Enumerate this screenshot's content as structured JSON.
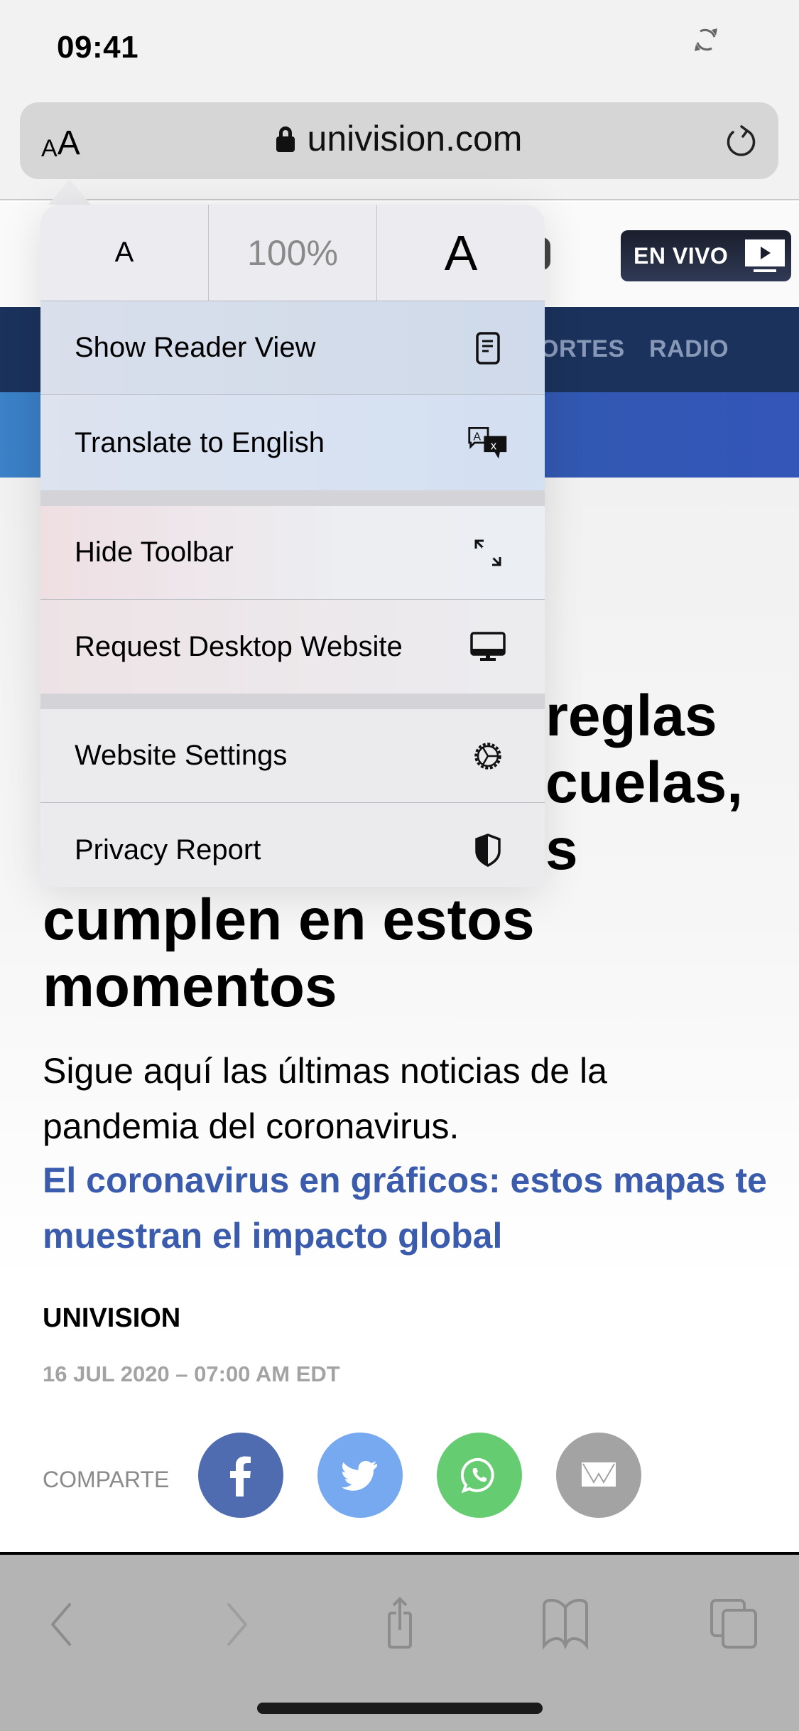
{
  "status_bar": {
    "time": "09:41",
    "sync_icon": "arrows-rotate-icon"
  },
  "url_bar": {
    "text_size_button": {
      "small_a": "A",
      "big_a": "A"
    },
    "domain": "univision.com",
    "lock_icon": "lock-icon",
    "reload_icon": "reload-icon"
  },
  "site": {
    "live_button": {
      "label": "EN VIVO",
      "icon": "tv-play-icon"
    },
    "nav": [
      {
        "label": "ORTES"
      },
      {
        "label": "RADIO"
      }
    ],
    "colors": {
      "nav_bg": "#1b325c",
      "subbar": "#3356b9",
      "live_bg": "#1a1e2c"
    }
  },
  "popover": {
    "zoom": {
      "decrease": "A",
      "level": "100%",
      "increase": "A"
    },
    "groups": [
      [
        {
          "label": "Show Reader View",
          "icon": "reader-view-icon"
        },
        {
          "label": "Translate to English",
          "icon": "translate-icon"
        }
      ],
      [
        {
          "label": "Hide Toolbar",
          "icon": "expand-arrows-icon"
        },
        {
          "label": "Request Desktop Website",
          "icon": "desktop-icon"
        }
      ],
      [
        {
          "label": "Website Settings",
          "icon": "gear-icon"
        },
        {
          "label": "Privacy Report",
          "icon": "shield-icon"
        }
      ]
    ]
  },
  "article": {
    "headline_partial": [
      "reglas",
      "cuelas,",
      "s"
    ],
    "headline_lines": [
      "cumplen en estos",
      "momentos"
    ],
    "summary": "Sigue aquí las últimas noticias de la pandemia del coronavirus.",
    "related_link": "El coronavirus en gráficos: estos mapas te muestran el impacto global",
    "author": "UNIVISION",
    "date": "16 JUL 2020 – 07:00 AM EDT",
    "share": {
      "label": "COMPARTE",
      "buttons": [
        {
          "name": "facebook",
          "icon": "facebook-icon",
          "color": "#506cb0"
        },
        {
          "name": "twitter",
          "icon": "twitter-icon",
          "color": "#76a9f0"
        },
        {
          "name": "whatsapp",
          "icon": "whatsapp-icon",
          "color": "#66cc72"
        },
        {
          "name": "email",
          "icon": "mail-icon",
          "color": "#a3a3a3"
        }
      ]
    }
  },
  "toolbar": {
    "items": [
      {
        "name": "back",
        "icon": "chevron-left-icon"
      },
      {
        "name": "forward",
        "icon": "chevron-right-icon"
      },
      {
        "name": "share",
        "icon": "share-icon"
      },
      {
        "name": "bookmarks",
        "icon": "book-icon"
      },
      {
        "name": "tabs",
        "icon": "tabs-icon"
      }
    ]
  }
}
